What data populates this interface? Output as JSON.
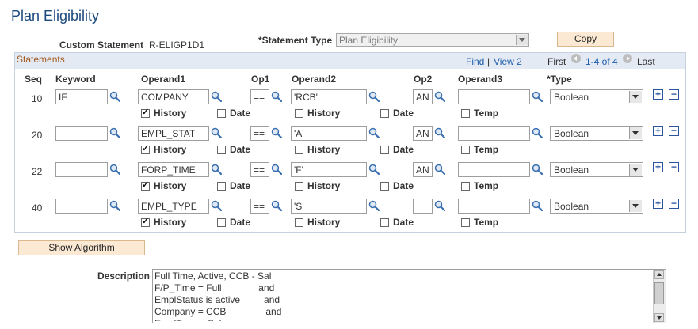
{
  "page": {
    "title": "Plan Eligibility"
  },
  "header": {
    "custom_statement_label": "Custom Statement",
    "custom_statement_value": "R-ELIGP1D1",
    "statement_type_label": "*Statement Type",
    "statement_type_value": "Plan Eligibility",
    "copy_label": "Copy"
  },
  "statements": {
    "title": "Statements",
    "find": "Find",
    "separator": "|",
    "view_all": "View 2",
    "first": "First",
    "range": "1-4 of 4",
    "last": "Last",
    "columns": [
      "Seq",
      "Keyword",
      "Operand1",
      "Op1",
      "Operand2",
      "Op2",
      "Operand3",
      "*Type"
    ],
    "checkbox_labels": {
      "history": "History",
      "date": "Date",
      "temp": "Temp"
    },
    "rows": [
      {
        "seq": "10",
        "keyword": "IF",
        "operand1": "COMPANY",
        "op1": "==",
        "operand2": "'RCB'",
        "op2": "AN",
        "operand3": "",
        "type": "Boolean",
        "history1": true,
        "date1": false,
        "history2": false,
        "date2": false,
        "temp": false
      },
      {
        "seq": "20",
        "keyword": "",
        "operand1": "EMPL_STAT",
        "op1": "==",
        "operand2": "'A'",
        "op2": "AN",
        "operand3": "",
        "type": "Boolean",
        "history1": true,
        "date1": false,
        "history2": false,
        "date2": false,
        "temp": false
      },
      {
        "seq": "22",
        "keyword": "",
        "operand1": "FORP_TIME",
        "op1": "==",
        "operand2": "'F'",
        "op2": "AN",
        "operand3": "",
        "type": "Boolean",
        "history1": true,
        "date1": false,
        "history2": false,
        "date2": false,
        "temp": false
      },
      {
        "seq": "40",
        "keyword": "",
        "operand1": "EMPL_TYPE",
        "op1": "==",
        "operand2": "'S'",
        "op2": "",
        "operand3": "",
        "type": "Boolean",
        "history1": true,
        "date1": false,
        "history2": false,
        "date2": false,
        "temp": false
      }
    ]
  },
  "algorithm": {
    "show_label": "Show Algorithm"
  },
  "description": {
    "label": "Description",
    "lines": [
      "Full Time, Active, CCB - Sal",
      "F/P_Time = Full              and",
      "EmplStatus is active         and",
      "Company = CCB               and",
      "EmplType = Sal"
    ]
  },
  "icons": {
    "lookup": "magnifier-icon",
    "add": "plus-icon",
    "remove": "minus-icon"
  },
  "colors": {
    "title": "#1d4a7e",
    "group_title": "#a45a1e",
    "link": "#1f5ea8",
    "button": "#fbe9d4"
  }
}
